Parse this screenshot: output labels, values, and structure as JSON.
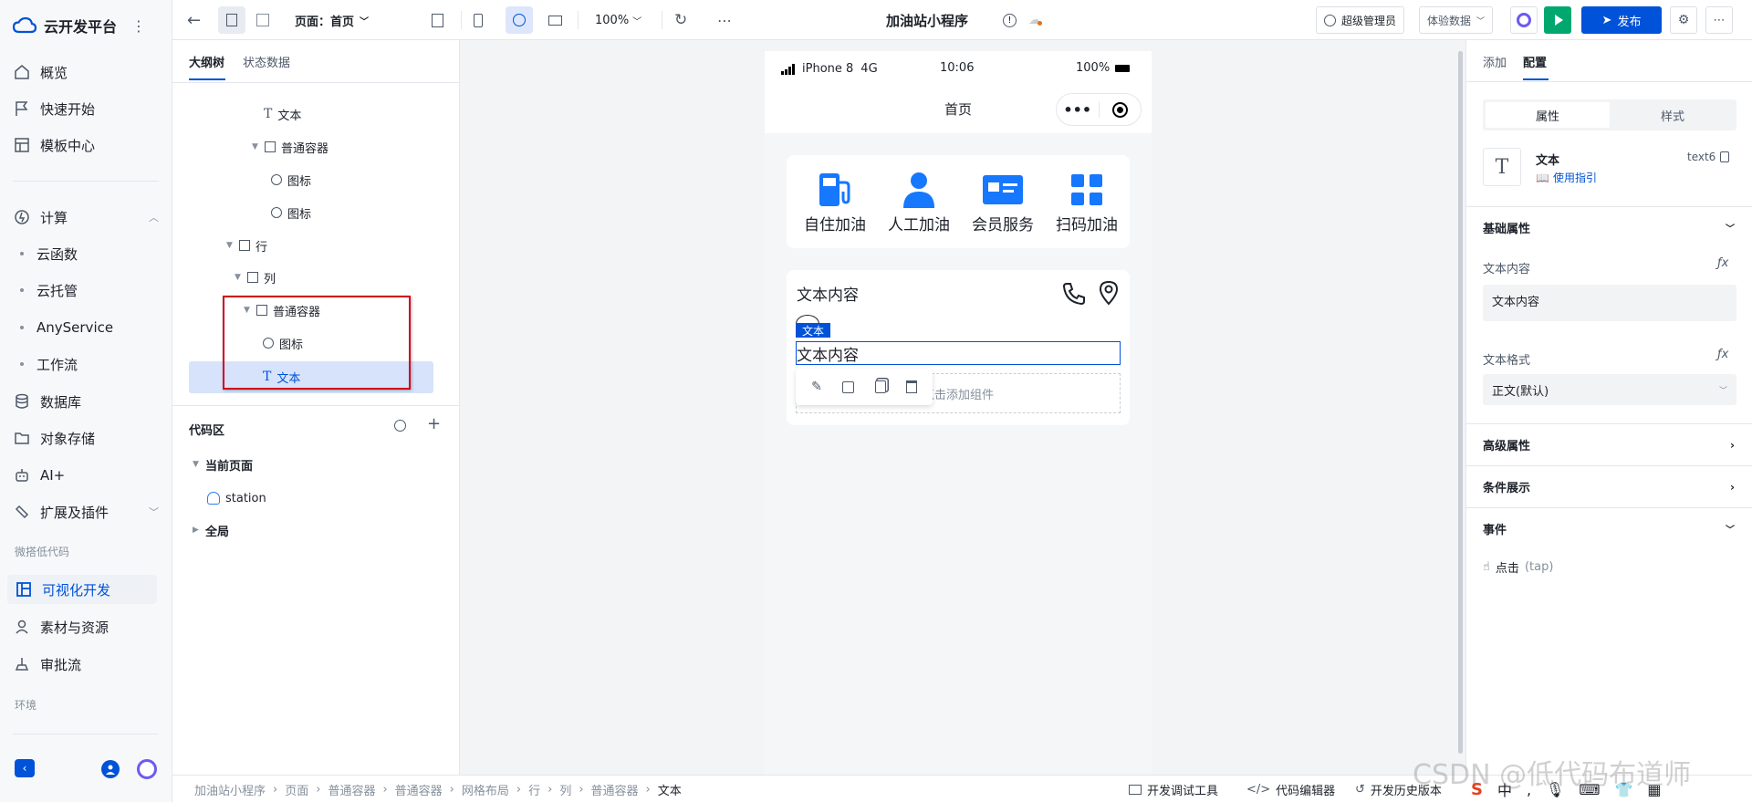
{
  "sidebar": {
    "brand": "云开发平台",
    "items": [
      {
        "label": "概览",
        "icon": "home-icon"
      },
      {
        "label": "快速开始",
        "icon": "flag-icon"
      },
      {
        "label": "模板中心",
        "icon": "template-icon"
      },
      {
        "label": "计算",
        "icon": "compute-icon"
      },
      {
        "label": "云函数"
      },
      {
        "label": "云托管"
      },
      {
        "label": "AnyService"
      },
      {
        "label": "工作流"
      },
      {
        "label": "数据库",
        "icon": "database-icon"
      },
      {
        "label": "对象存储",
        "icon": "storage-icon"
      },
      {
        "label": "AI+",
        "icon": "robot-icon"
      },
      {
        "label": "扩展及插件",
        "icon": "plugin-icon"
      },
      {
        "label": "可视化开发",
        "icon": "visual-dev-icon"
      },
      {
        "label": "素材与资源",
        "icon": "assets-icon"
      },
      {
        "label": "审批流",
        "icon": "approval-icon"
      }
    ],
    "group_lowcode": "微搭低代码",
    "group_env": "环境"
  },
  "toolbar": {
    "page_label": "页面：首页",
    "zoom": "100%",
    "app_title": "加油站小程序",
    "admin": "超级管理员",
    "data_mode": "体验数据",
    "publish": "发布"
  },
  "outline": {
    "tab_tree": "大纲树",
    "tab_state": "状态数据",
    "nodes": [
      {
        "label": "文本",
        "kind": "text"
      },
      {
        "label": "普通容器",
        "kind": "container"
      },
      {
        "label": "图标",
        "kind": "icon"
      },
      {
        "label": "图标",
        "kind": "icon"
      },
      {
        "label": "行",
        "kind": "container"
      },
      {
        "label": "列",
        "kind": "container"
      },
      {
        "label": "普通容器",
        "kind": "container"
      },
      {
        "label": "图标",
        "kind": "icon"
      },
      {
        "label": "文本",
        "kind": "text"
      }
    ],
    "code_title": "代码区",
    "current_page": "当前页面",
    "station": "station",
    "global": "全局"
  },
  "phone": {
    "carrier": "iPhone 8",
    "network": "4G",
    "time": "10:06",
    "battery": "100%",
    "page_title": "首页",
    "grid": [
      {
        "label": "自住加油",
        "icon": "fuel-pump-icon"
      },
      {
        "label": "人工加油",
        "icon": "person-icon"
      },
      {
        "label": "会员服务",
        "icon": "member-card-icon"
      },
      {
        "label": "扫码加油",
        "icon": "grid-apps-icon"
      }
    ],
    "card_title": "文本内容",
    "selected_tag": "文本",
    "selected_text": "文本内容",
    "add_component": "点击添加组件"
  },
  "config": {
    "tab_add": "添加",
    "tab_config": "配置",
    "seg_props": "属性",
    "seg_style": "样式",
    "comp_name": "文本",
    "comp_id": "text6",
    "usage_guide": "使用指引",
    "basic": "基础属性",
    "content_label": "文本内容",
    "content_value": "文本内容",
    "format_label": "文本格式",
    "format_value": "正文(默认)",
    "advanced": "高级属性",
    "condition": "条件展示",
    "events": "事件",
    "event_click": "点击",
    "event_tap": "(tap)"
  },
  "breadcrumb": [
    "加油站小程序",
    "页面",
    "普通容器",
    "普通容器",
    "网格布局",
    "行",
    "列",
    "普通容器",
    "文本"
  ],
  "bottom_tools": [
    "开发调试工具",
    "代码编辑器",
    "开发历史版本"
  ],
  "watermark": "CSDN @低代码布道师",
  "colors": {
    "accent": "#0052d9",
    "publish_bg": "#0052d9",
    "run_bg": "#00a870",
    "highlight": "#d0021b"
  }
}
